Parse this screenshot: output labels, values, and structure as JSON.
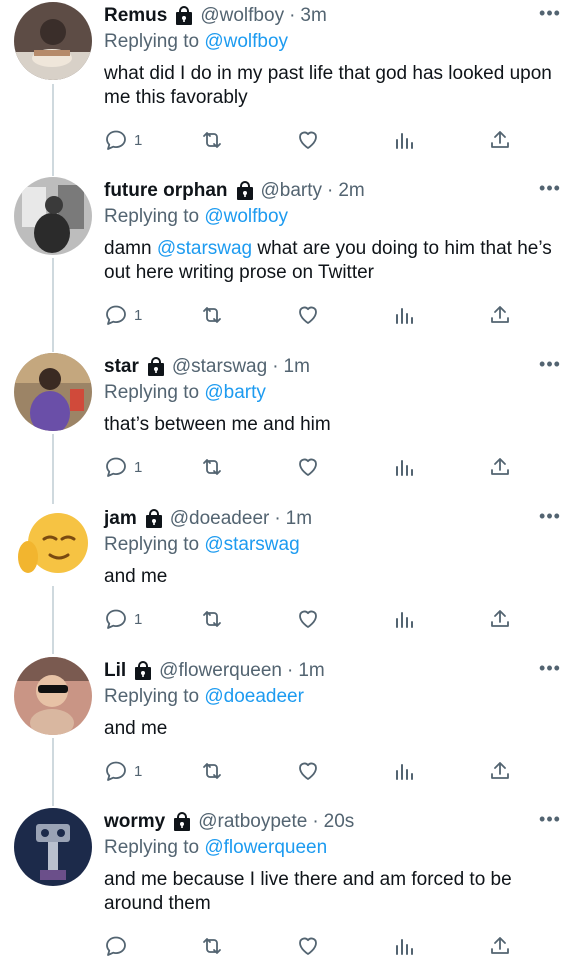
{
  "tweets": [
    {
      "name": "Remus",
      "handle": "@wolfboy",
      "separator": "·",
      "time": "3m",
      "replying_prefix": "Replying to",
      "replying_to": "@wolfboy",
      "text": "what did I do in my past life that god has looked upon me this favorably",
      "reply_count": "1",
      "avatar_color": "#6b5a52"
    },
    {
      "name": "future orphan",
      "handle": "@barty",
      "separator": "·",
      "time": "2m",
      "replying_prefix": "Replying to",
      "replying_to": "@wolfboy",
      "text_pre": "damn ",
      "text_mention": "@starswag",
      "text_post": " what are you doing to him that he’s out here writing prose on Twitter",
      "reply_count": "1",
      "avatar_color": "#9a9a9a"
    },
    {
      "name": "star",
      "handle": "@starswag",
      "separator": "·",
      "time": "1m",
      "replying_prefix": "Replying to",
      "replying_to": "@barty",
      "text": "that’s between me and him",
      "reply_count": "1",
      "avatar_color": "#8a6e52"
    },
    {
      "name": "jam",
      "handle": "@doeadeer",
      "separator": "·",
      "time": "1m",
      "replying_prefix": "Replying to",
      "replying_to": "@starswag",
      "text": "and me",
      "reply_count": "1",
      "avatar_color": "#f6c343"
    },
    {
      "name": "Lil",
      "handle": "@flowerqueen",
      "separator": "·",
      "time": "1m",
      "replying_prefix": "Replying to",
      "replying_to": "@doeadeer",
      "text": "and me",
      "reply_count": "1",
      "avatar_color": "#c98b7a"
    },
    {
      "name": "wormy",
      "handle": "@ratboypete",
      "separator": "·",
      "time": "20s",
      "replying_prefix": "Replying to",
      "replying_to": "@flowerqueen",
      "text": "and me because I live there and am forced to be around them",
      "reply_count": "",
      "avatar_color": "#1c2a4a"
    }
  ],
  "icons": {
    "reply": "reply-icon",
    "retweet": "retweet-icon",
    "like": "heart-icon",
    "analytics": "analytics-icon",
    "share": "share-icon",
    "lock": "lock-icon",
    "more": "more-icon"
  },
  "colors": {
    "link": "#1d9bf0",
    "secondary": "#536471",
    "primary": "#0f1419"
  }
}
